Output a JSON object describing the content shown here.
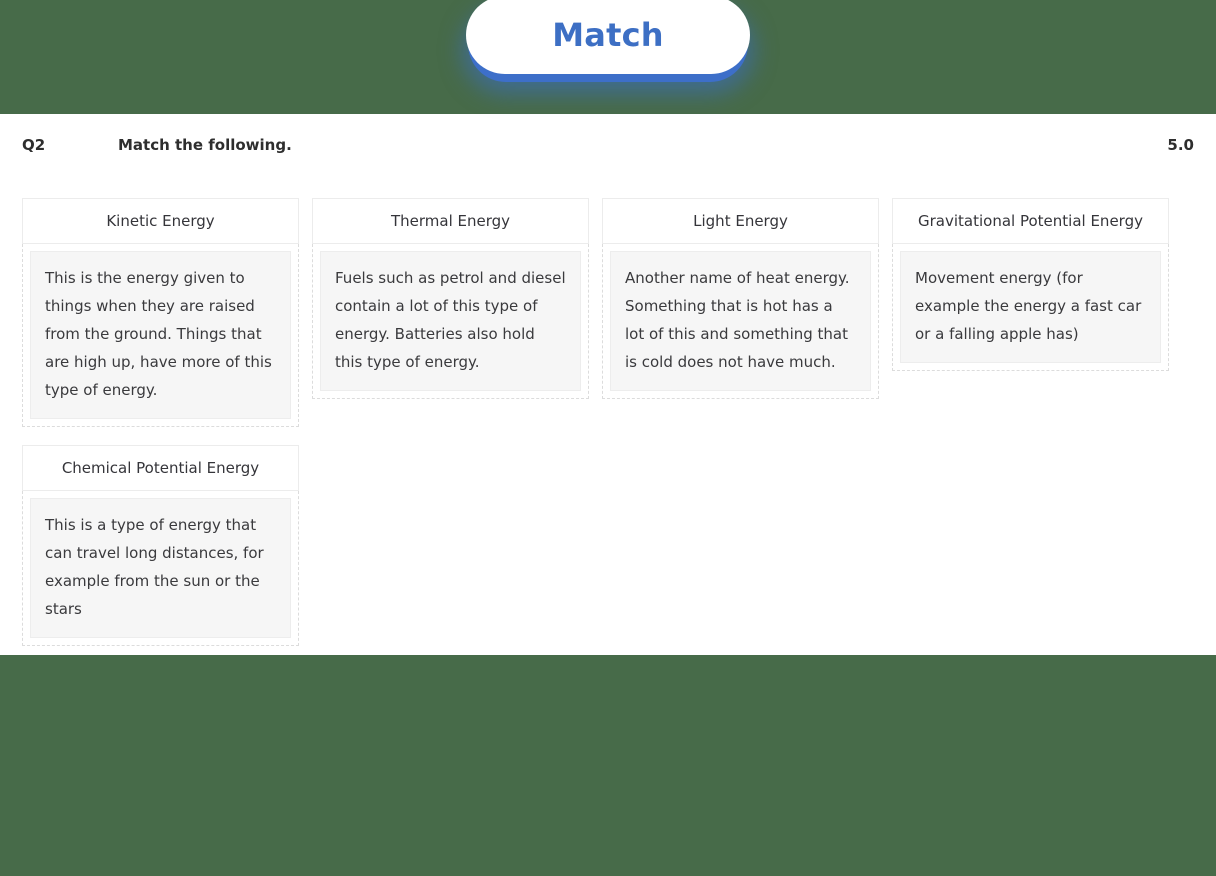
{
  "button": {
    "label": "Match",
    "accent_color": "#3d6fc4",
    "underlay_color": "#3d6fc9",
    "surface_color": "#ffffff"
  },
  "page": {
    "background_color": "#476b49",
    "sheet_color": "#ffffff"
  },
  "question": {
    "number": "Q2",
    "prompt": "Match the following.",
    "score": "5.0"
  },
  "cards": [
    {
      "term": "Kinetic Energy",
      "answer": "This is the energy given to things when they are raised from the ground. Things that are high up, have more of this type of energy."
    },
    {
      "term": "Thermal Energy",
      "answer": "Fuels such as petrol and diesel contain a lot of this type of energy. Batteries also hold this type of energy."
    },
    {
      "term": "Light Energy",
      "answer": "Another name of heat energy. Something that is hot has a lot of this and something that is cold does not have much."
    },
    {
      "term": "Gravitational Potential Energy",
      "answer": "Movement energy (for example the energy a fast car or a falling apple has)"
    },
    {
      "term": "Chemical Potential Energy",
      "answer": "This is a type of energy that can travel long distances, for example from the sun or the stars"
    }
  ]
}
